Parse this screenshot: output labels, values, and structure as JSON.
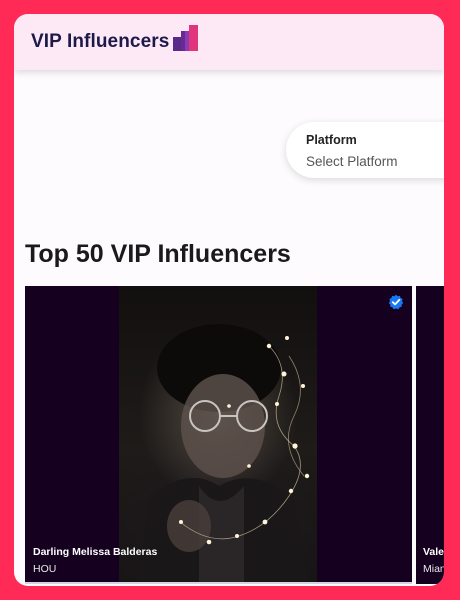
{
  "header": {
    "logo_text": "VIP Influencers",
    "logo_icon": "bar-chart-logo-icon"
  },
  "filter": {
    "label": "Platform",
    "value": "Select Platform"
  },
  "section": {
    "title": "Top 50 VIP Influencers"
  },
  "cards": [
    {
      "name": "Darling Melissa Balderas",
      "city": "HOU",
      "verified": true,
      "badge_icon": "verified-check-icon"
    },
    {
      "name": "Vale",
      "city": "Mian"
    }
  ],
  "colors": {
    "frame": "#ff2a55",
    "header_bg": "#fde9f6",
    "logo_text": "#1d1a4a",
    "card_bg": "#160020",
    "verified_badge": "#1877f2"
  }
}
